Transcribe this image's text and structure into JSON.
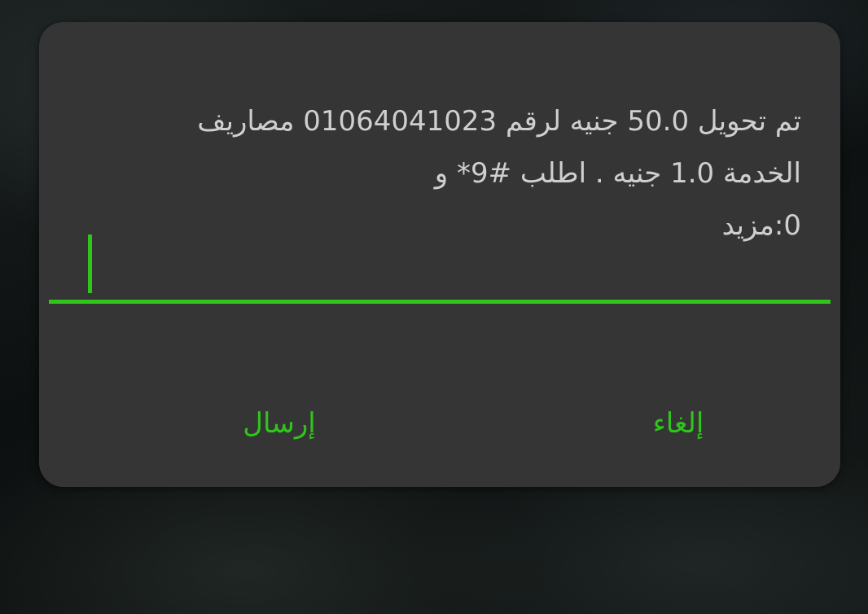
{
  "dialog": {
    "message_lines": [
      "تم تحويل 50.0 جنيه لرقم 01064041023 مصاريف",
      "الخدمة 1.0 جنيه . اطلب #9* و",
      "0:مزيد"
    ],
    "input": {
      "value": ""
    },
    "buttons": {
      "send_label": "إرسال",
      "cancel_label": "إلغاء"
    }
  },
  "colors": {
    "accent": "#2fc51b",
    "dialog_background": "#353535",
    "message_text": "#cfcfcf"
  }
}
